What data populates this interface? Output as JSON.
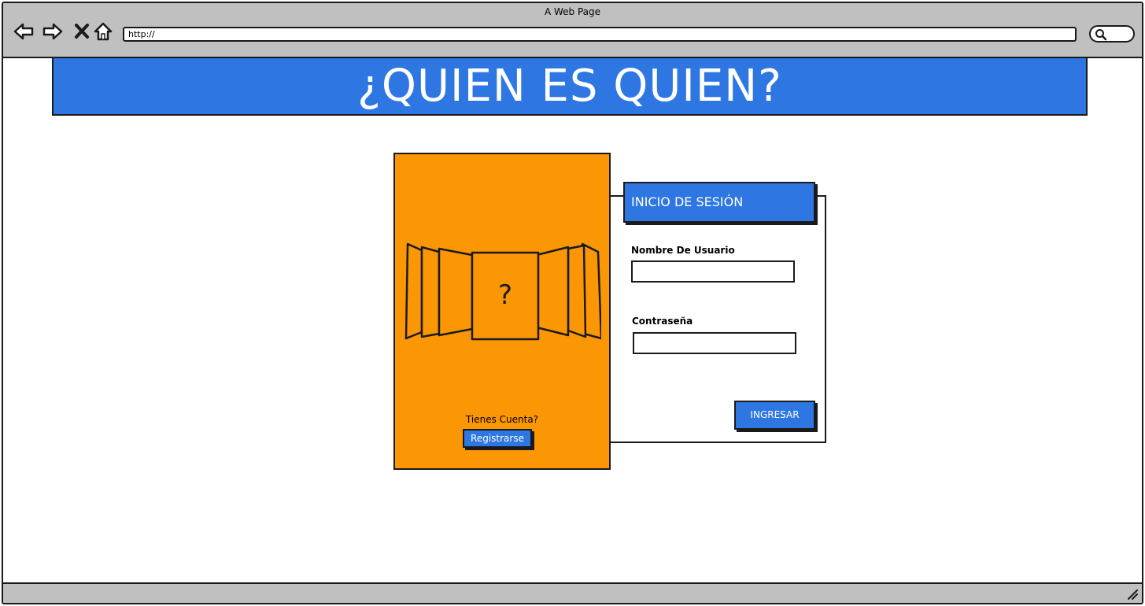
{
  "window": {
    "title": "A Web Page"
  },
  "browser": {
    "url": "http://",
    "nav_icons": [
      "back-arrow-icon",
      "forward-arrow-icon",
      "stop-icon",
      "home-icon"
    ],
    "search_icon": "search-icon"
  },
  "banner": {
    "title": "¿QUIEN ES QUIEN?",
    "color": "#2e77e2"
  },
  "left_panel": {
    "color": "#fb9604",
    "card_mark": "?",
    "register_prompt": "Tienes Cuenta?",
    "register_label": "Registrarse"
  },
  "login": {
    "header": "INICIO DE SESIÓN",
    "username_label": "Nombre De Usuario",
    "username_value": "",
    "password_label": "Contraseña",
    "password_value": "",
    "submit_label": "INGRESAR"
  }
}
